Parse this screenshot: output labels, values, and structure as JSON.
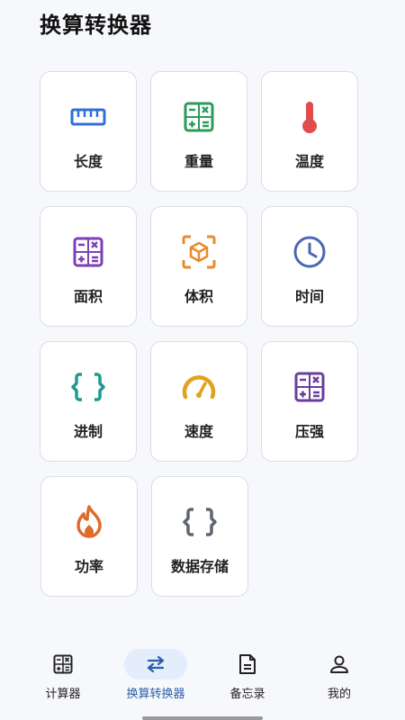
{
  "page": {
    "title": "换算转换器"
  },
  "cards": [
    {
      "label": "长度",
      "icon": "ruler-icon",
      "color": "#2f6fd6"
    },
    {
      "label": "重量",
      "icon": "calculator-icon",
      "color": "#2e9a5c"
    },
    {
      "label": "温度",
      "icon": "thermometer-icon",
      "color": "#e04b4b"
    },
    {
      "label": "面积",
      "icon": "calculator-icon",
      "color": "#7b3fb8"
    },
    {
      "label": "体积",
      "icon": "cube-scan-icon",
      "color": "#e98a2a"
    },
    {
      "label": "时间",
      "icon": "clock-icon",
      "color": "#4a67b3"
    },
    {
      "label": "进制",
      "icon": "braces-icon",
      "color": "#1e9a90"
    },
    {
      "label": "速度",
      "icon": "speedometer-icon",
      "color": "#e0a21a"
    },
    {
      "label": "压强",
      "icon": "calculator-icon",
      "color": "#6a3e9e"
    },
    {
      "label": "功率",
      "icon": "flame-icon",
      "color": "#e06a2a"
    },
    {
      "label": "数据存储",
      "icon": "braces-icon",
      "color": "#5f6670"
    }
  ],
  "nav": [
    {
      "label": "计算器",
      "icon": "calculator-icon",
      "active": false
    },
    {
      "label": "换算转换器",
      "icon": "swap-arrows-icon",
      "active": true
    },
    {
      "label": "备忘录",
      "icon": "document-icon",
      "active": false
    },
    {
      "label": "我的",
      "icon": "person-icon",
      "active": false
    }
  ]
}
